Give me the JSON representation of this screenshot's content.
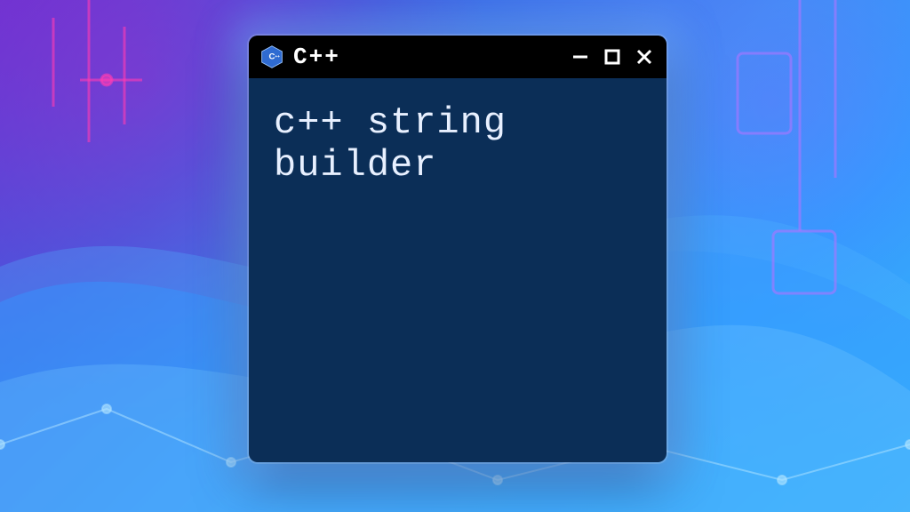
{
  "window": {
    "title": "C++",
    "icon_name": "cpp-logo-icon",
    "controls": {
      "minimize": "minimize",
      "maximize": "maximize",
      "close": "close"
    }
  },
  "content": {
    "text": "c++ string\nbuilder"
  },
  "colors": {
    "titlebar_bg": "#000000",
    "content_bg": "#0b2e57",
    "content_fg": "#e8f0ff",
    "icon_fill": "#2f6bd1"
  }
}
